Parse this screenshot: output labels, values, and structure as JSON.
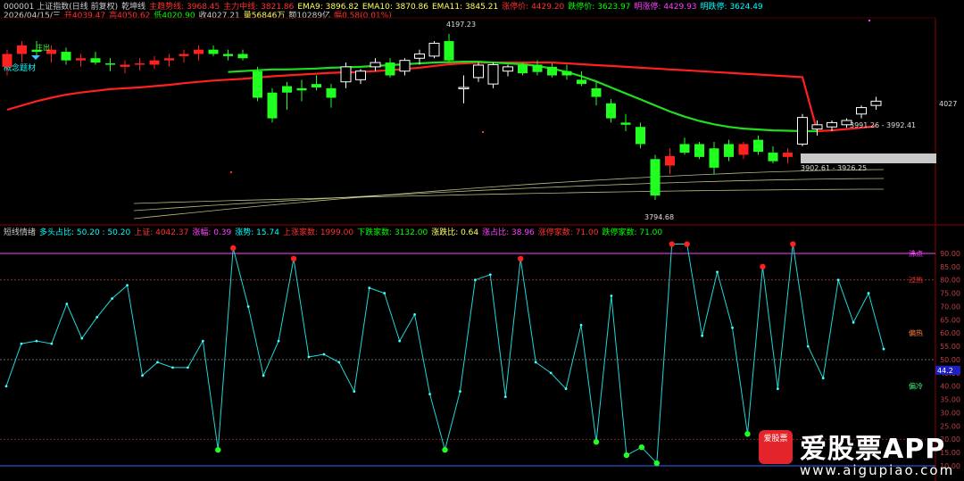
{
  "header": {
    "line1": [
      {
        "text": "000001 上证指数(日线 前复权)",
        "color": "#cccccc"
      },
      {
        "text": "乾坤线",
        "color": "#cccccc"
      },
      {
        "text": "主趋势线: 3968.45",
        "color": "#ff3030"
      },
      {
        "text": "主力中线: 3821.86",
        "color": "#ff3030"
      },
      {
        "text": "EMA9: 3896.82",
        "color": "#ffff60"
      },
      {
        "text": "EMA10: 3870.86",
        "color": "#ffff60"
      },
      {
        "text": "EMA11: 3845.21",
        "color": "#ffff60"
      },
      {
        "text": "涨停价: 4429.20",
        "color": "#ff3030"
      },
      {
        "text": "跌停价: 3623.97",
        "color": "#00ff00"
      },
      {
        "text": "明涨停: 4429.93",
        "color": "#ff40ff"
      },
      {
        "text": "明跌停: 3624.49",
        "color": "#00ffff"
      }
    ],
    "line2": [
      {
        "text": "2026/04/15/三",
        "color": "#cccccc"
      },
      {
        "text": "开4039.47",
        "color": "#ff3030"
      },
      {
        "text": "高4050.62",
        "color": "#ff3030"
      },
      {
        "text": "低4020.90",
        "color": "#00ff00"
      },
      {
        "text": "收4027.21",
        "color": "#cccccc"
      },
      {
        "text": "量56846万",
        "color": "#ffff60"
      },
      {
        "text": "额10289亿",
        "color": "#cccccc"
      },
      {
        "text": "幅0.58(0.01%)",
        "color": "#ff3030"
      }
    ],
    "line3": [
      {
        "text": "概念题材",
        "color": "#00ffff"
      }
    ]
  },
  "price_labels": {
    "high": "4197.23",
    "low": "3794.68",
    "range_top": "3991.26 - 3992.41",
    "range_bottom": "3902.61 - 3926.25",
    "right_axis": "4027",
    "zhuchu": "庄出"
  },
  "indicator_header": [
    {
      "text": "短线情绪",
      "color": "#cccccc"
    },
    {
      "text": "多头占比: 50.20 : 50.20",
      "color": "#00ffff"
    },
    {
      "text": "上证: 4042.37",
      "color": "#ff3030"
    },
    {
      "text": "涨幅: 0.39",
      "color": "#ff40ff"
    },
    {
      "text": "涨势: 15.74",
      "color": "#00ffff"
    },
    {
      "text": "上涨家数: 1999.00",
      "color": "#ff3030"
    },
    {
      "text": "下跌家数: 3132.00",
      "color": "#00ff00"
    },
    {
      "text": "涨跌比: 0.64",
      "color": "#ffff60"
    },
    {
      "text": "涨占比: 38.96",
      "color": "#ff40ff"
    },
    {
      "text": "涨停家数: 71.00",
      "color": "#ff3030"
    },
    {
      "text": "跌停家数: 71.00",
      "color": "#00ff00"
    }
  ],
  "zone_labels": {
    "boil": "沸点",
    "overheat": "过热",
    "warm": "偏热",
    "cool": "偏冷"
  },
  "y_ticks": [
    "90.00",
    "85.00",
    "80.00",
    "75.00",
    "70.00",
    "65.00",
    "60.00",
    "55.00",
    "50.00",
    "45.00",
    "40.00",
    "35.00",
    "30.00",
    "25.00",
    "20.00",
    "15.00",
    "10.00"
  ],
  "current_value": "44.2",
  "watermark": {
    "logo_text": "爱股票",
    "title": "爱股票APP",
    "url": "www.aigupiao.com"
  },
  "chart_data": [
    {
      "type": "candlestick",
      "title": "",
      "ylim": [
        3760,
        4230
      ],
      "candles": [
        [
          4120,
          4160,
          4100,
          4150
        ],
        [
          4150,
          4180,
          4130,
          4170
        ],
        [
          4160,
          4180,
          4140,
          4155
        ],
        [
          4150,
          4170,
          4130,
          4160
        ],
        [
          4155,
          4165,
          4125,
          4135
        ],
        [
          4135,
          4150,
          4120,
          4140
        ],
        [
          4140,
          4155,
          4125,
          4130
        ],
        [
          4128,
          4140,
          4110,
          4125
        ],
        [
          4120,
          4135,
          4105,
          4125
        ],
        [
          4125,
          4140,
          4112,
          4128
        ],
        [
          4125,
          4145,
          4115,
          4135
        ],
        [
          4135,
          4150,
          4120,
          4140
        ],
        [
          4145,
          4160,
          4130,
          4150
        ],
        [
          4150,
          4170,
          4135,
          4160
        ],
        [
          4160,
          4170,
          4145,
          4150
        ],
        [
          4150,
          4160,
          4135,
          4145
        ],
        [
          4150,
          4160,
          4135,
          4140
        ],
        [
          4110,
          4120,
          4040,
          4048
        ],
        [
          4060,
          4070,
          3990,
          4000
        ],
        [
          4075,
          4085,
          4020,
          4060
        ],
        [
          4070,
          4090,
          4040,
          4065
        ],
        [
          4080,
          4100,
          4065,
          4072
        ],
        [
          4070,
          4080,
          4025,
          4048
        ],
        [
          4085,
          4130,
          4070,
          4120
        ],
        [
          4090,
          4115,
          4080,
          4110
        ],
        [
          4120,
          4140,
          4110,
          4130
        ],
        [
          4130,
          4140,
          4095,
          4100
        ],
        [
          4110,
          4140,
          4100,
          4135
        ],
        [
          4140,
          4160,
          4125,
          4150
        ],
        [
          4145,
          4180,
          4140,
          4175
        ],
        [
          4180,
          4197,
          4130,
          4135
        ],
        [
          4072,
          4100,
          4035,
          4072
        ],
        [
          4095,
          4130,
          4085,
          4124
        ],
        [
          4080,
          4130,
          4070,
          4125
        ],
        [
          4110,
          4125,
          4098,
          4120
        ],
        [
          4125,
          4130,
          4100,
          4105
        ],
        [
          4125,
          4135,
          4100,
          4108
        ],
        [
          4120,
          4128,
          4095,
          4100
        ],
        [
          4110,
          4125,
          4090,
          4100
        ],
        [
          4090,
          4110,
          4075,
          4080
        ],
        [
          4070,
          4085,
          4030,
          4050
        ],
        [
          4035,
          4045,
          3990,
          4000
        ],
        [
          3990,
          4010,
          3970,
          3985
        ],
        [
          3980,
          3990,
          3930,
          3940
        ],
        [
          3905,
          3915,
          3810,
          3820
        ],
        [
          3890,
          3930,
          3870,
          3912
        ],
        [
          3940,
          3955,
          3915,
          3920
        ],
        [
          3940,
          3945,
          3905,
          3910
        ],
        [
          3930,
          3945,
          3870,
          3885
        ],
        [
          3940,
          3950,
          3900,
          3910
        ],
        [
          3915,
          3945,
          3905,
          3940
        ],
        [
          3950,
          3960,
          3915,
          3922
        ],
        [
          3920,
          3935,
          3895,
          3900
        ],
        [
          3910,
          3930,
          3895,
          3920
        ],
        [
          3940,
          4010,
          3935,
          4002
        ],
        [
          3975,
          3995,
          3960,
          3985
        ],
        [
          3980,
          3995,
          3970,
          3990
        ],
        [
          3985,
          4000,
          3978,
          3995
        ],
        [
          4010,
          4030,
          4000,
          4025
        ],
        [
          4030,
          4050,
          4020,
          4040
        ]
      ],
      "lines": {
        "main_trend": {
          "color": "#ff2020",
          "values": [
            4020,
            4030,
            4040,
            4048,
            4055,
            4060,
            4064,
            4068,
            4070,
            4072,
            4075,
            4078,
            4082,
            4085,
            4088,
            4090,
            4092,
            4095,
            4098,
            4100,
            4102,
            4104,
            4106,
            4107,
            4108,
            4110,
            4112,
            4115,
            4118,
            4122,
            4126,
            4128,
            4130,
            4130,
            4130,
            4130,
            4130,
            4130,
            4128,
            4126,
            4124,
            4122,
            4120,
            4118,
            4116,
            4114,
            4112,
            4110,
            4108,
            4106,
            4104,
            4102,
            4100,
            4098,
            4096,
            3970,
            3972,
            3975,
            3978,
            3982
          ]
        },
        "main_green": {
          "color": "#20dd20",
          "values": [
            null,
            null,
            null,
            null,
            null,
            null,
            null,
            null,
            null,
            null,
            null,
            null,
            null,
            null,
            null,
            4108,
            4110,
            4112,
            4114,
            4114,
            4115,
            4116,
            4118,
            4119,
            4120,
            4122,
            4124,
            4126,
            4128,
            4130,
            4131,
            4132,
            4132,
            4130,
            4128,
            4126,
            4122,
            4116,
            4108,
            4098,
            4086,
            4072,
            4058,
            4044,
            4030,
            4016,
            4004,
            3994,
            3986,
            3980,
            3976,
            3974,
            3972,
            3971,
            3970,
            3970,
            null,
            null,
            null,
            null
          ]
        }
      }
    },
    {
      "type": "line",
      "title": "",
      "ylim": [
        10,
        92
      ],
      "series": [
        {
          "values": [
            40,
            56,
            57,
            56,
            71,
            58,
            66,
            73,
            78,
            44,
            49,
            47,
            47,
            57,
            16,
            92,
            70,
            44,
            57,
            88,
            51,
            52,
            49,
            38,
            77,
            75,
            57,
            67,
            37,
            16,
            38,
            80,
            82,
            36,
            88,
            49,
            45,
            39,
            63,
            19,
            74,
            14,
            17,
            11,
            99,
            94,
            59,
            83,
            62,
            22,
            85,
            39,
            98,
            55,
            43,
            80,
            64,
            75,
            54
          ]
        }
      ]
    }
  ]
}
